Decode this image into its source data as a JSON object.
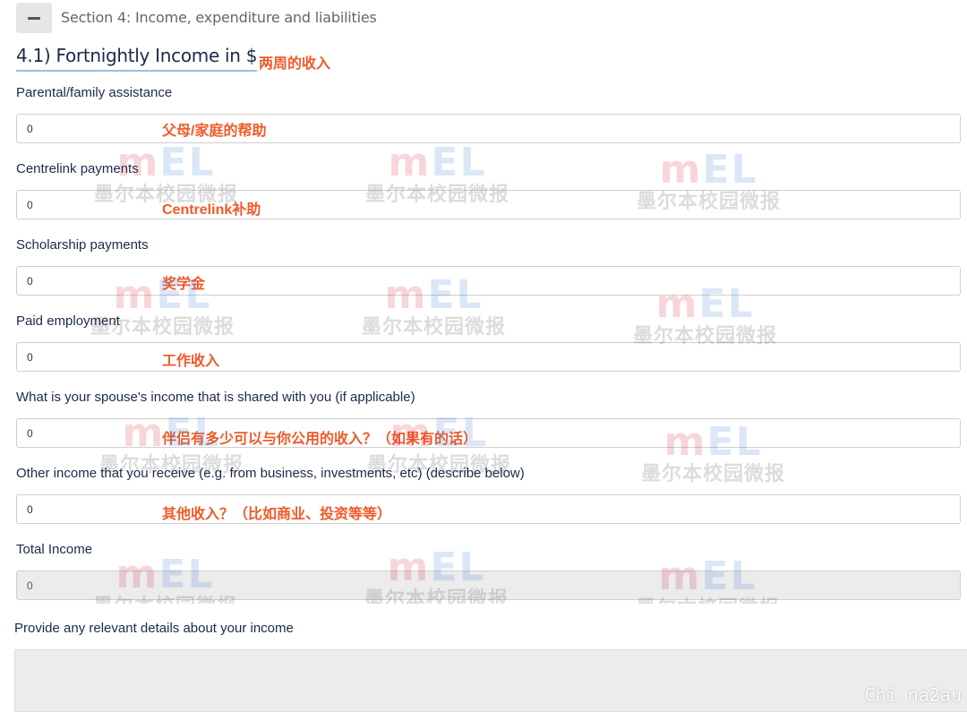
{
  "section": {
    "title": "Section 4: Income, expenditure and liabilities",
    "collapse_icon": "minus-icon"
  },
  "heading": {
    "title": "4.1) Fortnightly Income in $",
    "note": "两周的收入"
  },
  "fields": [
    {
      "label": "Parental/family assistance",
      "value": "0",
      "note": "父母/家庭的帮助"
    },
    {
      "label": "Centrelink payments",
      "value": "0",
      "note": "Centrelink补助"
    },
    {
      "label": "Scholarship payments",
      "value": "0",
      "note": "奖学金"
    },
    {
      "label": "Paid employment",
      "value": "0",
      "note": "工作收入"
    },
    {
      "label": "What is your spouse's income that is shared with you (if applicable)",
      "value": "0",
      "note": "伴侣有多少可以与你公用的收入？（如果有的话）"
    },
    {
      "label": "Other income that you receive (e.g. from business, investments, etc) (describe below)",
      "value": "0",
      "note": "其他收入？（比如商业、投资等等）"
    }
  ],
  "total": {
    "label": "Total Income",
    "value": "0"
  },
  "details": {
    "label": "Provide any relevant details about your income",
    "value": ""
  },
  "watermark": {
    "logo_part1": "m",
    "logo_part2": "EL",
    "text": "墨尔本校园微报"
  },
  "corner_mark": "Chi na2au",
  "colors": {
    "annotation": "#f05a28",
    "heading_underline": "#8fc3e8",
    "text": "#1b2a4a",
    "readonly_bg": "#ececec"
  }
}
